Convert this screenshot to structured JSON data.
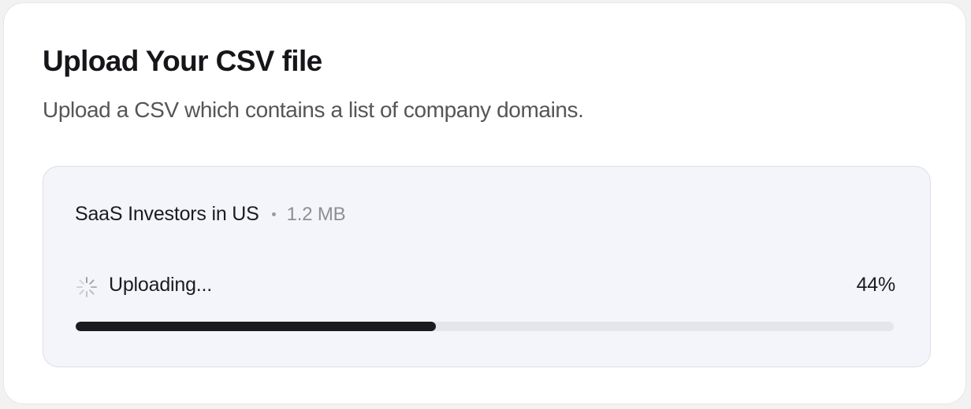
{
  "card": {
    "title": "Upload Your CSV file",
    "subtitle": "Upload a CSV which contains a list of company domains."
  },
  "file": {
    "name": "SaaS Investors in US",
    "size": "1.2 MB"
  },
  "upload": {
    "status_icon": "spinner-icon",
    "status_label": "Uploading...",
    "progress_label": "44%",
    "progress_percent": 44
  },
  "colors": {
    "progress_fill": "#1c1c1f",
    "progress_track": "#e6e6ea",
    "panel_background": "#f4f5fa"
  }
}
